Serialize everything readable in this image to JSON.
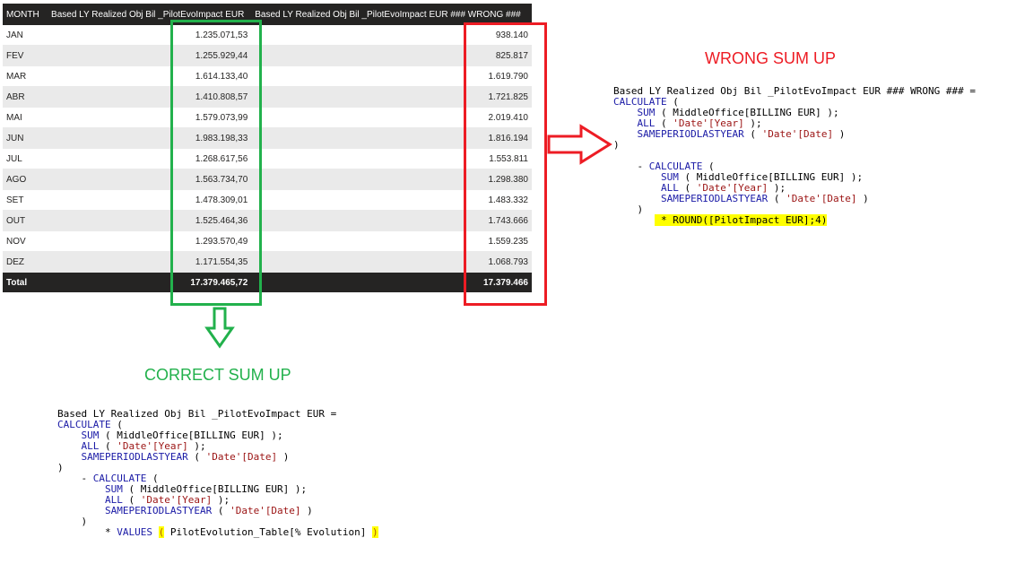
{
  "table": {
    "headers": [
      "MONTH",
      "Based LY Realized Obj Bil _PilotEvoImpact EUR",
      "Based LY Realized Obj Bil _PilotEvoImpact EUR ### WRONG ###"
    ],
    "rows": [
      {
        "month": "JAN",
        "correct": "1.235.071,53",
        "wrong": "938.140"
      },
      {
        "month": "FEV",
        "correct": "1.255.929,44",
        "wrong": "825.817"
      },
      {
        "month": "MAR",
        "correct": "1.614.133,40",
        "wrong": "1.619.790"
      },
      {
        "month": "ABR",
        "correct": "1.410.808,57",
        "wrong": "1.721.825"
      },
      {
        "month": "MAI",
        "correct": "1.579.073,99",
        "wrong": "2.019.410"
      },
      {
        "month": "JUN",
        "correct": "1.983.198,33",
        "wrong": "1.816.194"
      },
      {
        "month": "JUL",
        "correct": "1.268.617,56",
        "wrong": "1.553.811"
      },
      {
        "month": "AGO",
        "correct": "1.563.734,70",
        "wrong": "1.298.380"
      },
      {
        "month": "SET",
        "correct": "1.478.309,01",
        "wrong": "1.483.332"
      },
      {
        "month": "OUT",
        "correct": "1.525.464,36",
        "wrong": "1.743.666"
      },
      {
        "month": "NOV",
        "correct": "1.293.570,49",
        "wrong": "1.559.235"
      },
      {
        "month": "DEZ",
        "correct": "1.171.554,35",
        "wrong": "1.068.793"
      }
    ],
    "total": {
      "label": "Total",
      "correct": "17.379.465,72",
      "wrong": "17.379.466"
    }
  },
  "annotations": {
    "wrong_label": "WRONG SUM UP",
    "correct_label": "CORRECT SUM UP",
    "wrong_color": "#ed1c24",
    "correct_color": "#22b14c"
  },
  "code_wrong": {
    "l1": "Based LY Realized Obj Bil _PilotEvoImpact EUR ### WRONG ### =",
    "kw_calculate": "CALCULATE",
    "paren_open": " (",
    "kw_sum": "SUM",
    "sum_args": " ( MiddleOffice[BILLING EUR] );",
    "kw_all": "ALL",
    "all_open": " ( ",
    "all_str": "'Date'[Year]",
    "all_close": " );",
    "kw_spl": "SAMEPERIODLASTYEAR",
    "spl_open": " ( ",
    "spl_str": "'Date'[Date]",
    "spl_close": " )",
    "close": ")",
    "minus": "- ",
    "round_line": " * ROUND([PilotImpact EUR];4)"
  },
  "code_correct": {
    "l1": "Based LY Realized Obj Bil _PilotEvoImpact EUR =",
    "kw_calculate": "CALCULATE",
    "paren_open": " (",
    "kw_sum": "SUM",
    "sum_args": " ( MiddleOffice[BILLING EUR] );",
    "kw_all": "ALL",
    "all_open": " ( ",
    "all_str": "'Date'[Year]",
    "all_close": " );",
    "kw_spl": "SAMEPERIODLASTYEAR",
    "spl_open": " ( ",
    "spl_str": "'Date'[Date]",
    "spl_close": " )",
    "close": ")",
    "minus": "- ",
    "values_pre": "* ",
    "kw_values": "VALUES",
    "values_paren_open": "(",
    "values_arg": " PilotEvolution_Table[% Evolution] ",
    "values_paren_close": ")"
  }
}
